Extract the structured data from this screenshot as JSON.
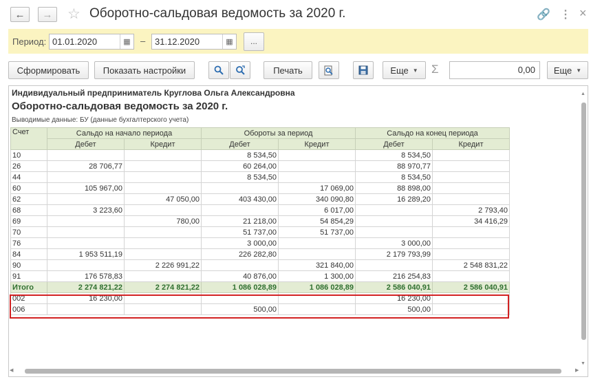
{
  "window": {
    "title": "Оборотно-сальдовая ведомость за 2020 г."
  },
  "period": {
    "label": "Период:",
    "from": "01.01.2020",
    "dash": "–",
    "to": "31.12.2020",
    "more": "..."
  },
  "toolbar": {
    "generate": "Сформировать",
    "show_settings": "Показать настройки",
    "print": "Печать",
    "more1": "Еще",
    "sum_value": "0,00",
    "more2": "Еще"
  },
  "report": {
    "org": "Индивидуальный предприниматель Круглова Ольга Александровна",
    "title": "Оборотно-сальдовая ведомость за 2020 г.",
    "shown_data": "Выводимые данные:  БУ (данные бухгалтерского учета)",
    "headers": {
      "account": "Счет",
      "opening": "Сальдо на начало периода",
      "turnover": "Обороты за период",
      "closing": "Сальдо на конец периода",
      "debit": "Дебет",
      "credit": "Кредит"
    },
    "rows": [
      [
        "10",
        "",
        "",
        "8 534,50",
        "",
        "8 534,50",
        ""
      ],
      [
        "26",
        "28 706,77",
        "",
        "60 264,00",
        "",
        "88 970,77",
        ""
      ],
      [
        "44",
        "",
        "",
        "8 534,50",
        "",
        "8 534,50",
        ""
      ],
      [
        "60",
        "105 967,00",
        "",
        "",
        "17 069,00",
        "88 898,00",
        ""
      ],
      [
        "62",
        "",
        "47 050,00",
        "403 430,00",
        "340 090,80",
        "16 289,20",
        ""
      ],
      [
        "68",
        "3 223,60",
        "",
        "",
        "6 017,00",
        "",
        "2 793,40"
      ],
      [
        "69",
        "",
        "780,00",
        "21 218,00",
        "54 854,29",
        "",
        "34 416,29"
      ],
      [
        "70",
        "",
        "",
        "51 737,00",
        "51 737,00",
        "",
        ""
      ],
      [
        "76",
        "",
        "",
        "3 000,00",
        "",
        "3 000,00",
        ""
      ],
      [
        "84",
        "1 953 511,19",
        "",
        "226 282,80",
        "",
        "2 179 793,99",
        ""
      ],
      [
        "90",
        "",
        "2 226 991,22",
        "",
        "321 840,00",
        "",
        "2 548 831,22"
      ],
      [
        "91",
        "176 578,83",
        "",
        "40 876,00",
        "1 300,00",
        "216 254,83",
        ""
      ]
    ],
    "total": [
      "Итого",
      "2 274 821,22",
      "2 274 821,22",
      "1 086 028,89",
      "1 086 028,89",
      "2 586 040,91",
      "2 586 040,91"
    ],
    "offbalance": [
      [
        "002",
        "16 230,00",
        "",
        "",
        "",
        "16 230,00",
        ""
      ],
      [
        "006",
        "",
        "",
        "500,00",
        "",
        "500,00",
        ""
      ]
    ]
  },
  "colors": {
    "header_bg": "#e3ecd3",
    "total_text": "#2f6f2f",
    "period_bar": "#fbf4c1",
    "highlight": "#d22121"
  },
  "icons": [
    "back-arrow-icon",
    "forward-arrow-icon",
    "star-icon",
    "link-icon",
    "more-vert-icon",
    "close-icon",
    "calendar-icon",
    "search-icon",
    "refresh-search-icon",
    "preview-icon",
    "save-icon",
    "sigma-icon"
  ]
}
